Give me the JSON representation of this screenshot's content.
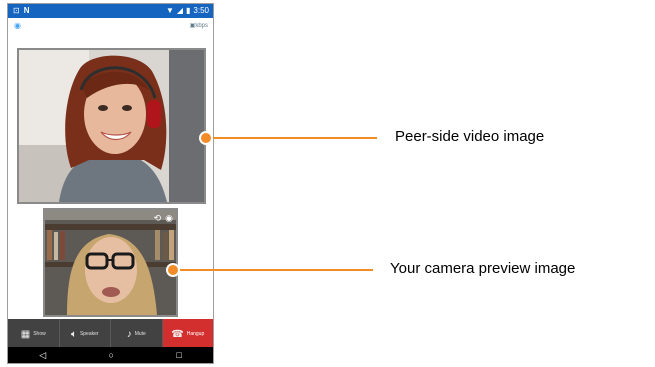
{
  "status_bar": {
    "left_icons": [
      "cast-icon",
      "nfc-icon"
    ],
    "time": "3:50",
    "background": "#1565c0"
  },
  "sub_bar": {
    "bitrate": "kbps"
  },
  "preview": {
    "icons": [
      "switch-camera-icon",
      "camera-toggle-icon"
    ]
  },
  "toolbar": {
    "buttons": [
      {
        "icon": "grid-icon",
        "label": "Show"
      },
      {
        "icon": "speaker-icon",
        "label": "Speaker"
      },
      {
        "icon": "mic-icon",
        "label": "Mute"
      },
      {
        "icon": "phone-hangup-icon",
        "label": "Hangup"
      }
    ],
    "hangup_color": "#d32f2f"
  },
  "nav": {
    "icons": [
      "back-icon",
      "home-icon",
      "recents-icon"
    ]
  },
  "callouts": {
    "peer_label": "Peer-side video image",
    "self_label": "Your camera preview image",
    "accent": "#f28c28"
  }
}
